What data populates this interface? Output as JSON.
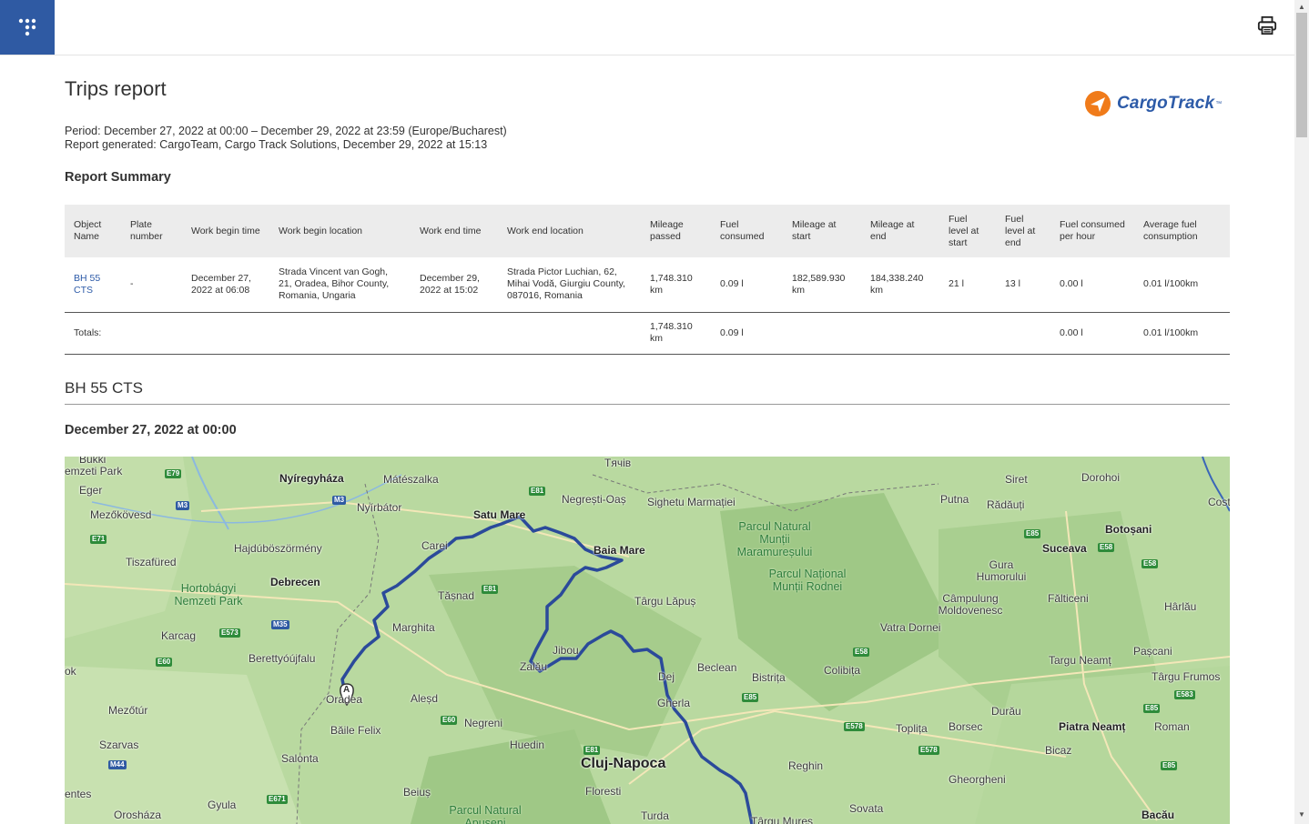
{
  "header": {
    "print_icon": "printer-icon",
    "logo_icon": "dots-logo-icon"
  },
  "report": {
    "title": "Trips report",
    "brand_name": "CargoTrack",
    "brand_tm": "™",
    "period": "Period: December 27, 2022 at 00:00 – December 29, 2022 at 23:59 (Europe/Bucharest)",
    "generated": "Report generated: CargoTeam, Cargo Track Solutions, December 29, 2022 at 15:13",
    "summary_heading": "Report Summary"
  },
  "summary_table": {
    "headers": [
      "Object Name",
      "Plate number",
      "Work begin time",
      "Work begin location",
      "Work end time",
      "Work end location",
      "Mileage passed",
      "Fuel consumed",
      "Mileage at start",
      "Mileage at end",
      "Fuel level at start",
      "Fuel level at end",
      "Fuel consumed per hour",
      "Average fuel consumption"
    ],
    "rows": [
      [
        "BH 55 CTS",
        "-",
        "December 27, 2022 at 06:08",
        "Strada Vincent van Gogh, 21, Oradea, Bihor County, Romania, Ungaria",
        "December 29, 2022 at 15:02",
        "Strada Pictor Luchian, 62, Mihai Vodă, Giurgiu County, 087016, Romania",
        "1,748.310 km",
        "0.09 l",
        "182,589.930 km",
        "184,338.240 km",
        "21 l",
        "13 l",
        "0.00 l",
        "0.01 l/100km"
      ]
    ],
    "totals": {
      "label": "Totals:",
      "mileage": "1,748.310 km",
      "fuel": "0.09 l",
      "per_hour": "0.00 l",
      "average": "0.01 l/100km"
    }
  },
  "vehicle": {
    "name": "BH 55 CTS",
    "date": "December 27, 2022 at 00:00"
  },
  "map": {
    "marker_label": "A",
    "route_color": "#2b4a9a",
    "cities": [
      "Bukki",
      "emzeti Park",
      "Eger",
      "Mezőkövesd",
      "Nyíregyháza",
      "Mátészalka",
      "Nyírbátor",
      "Tячів",
      "Negrești-Oaș",
      "Sighetu Marmației",
      "Satu Mare",
      "Carei",
      "Baia Mare",
      "Hajdúböszörmény",
      "Tiszafüred",
      "Debrecen",
      "Tășnad",
      "Târgu Lăpuș",
      "Karcag",
      "Marghita",
      "Berettyóújfalu",
      "Jibou",
      "Zalău",
      "ok",
      "Oradea",
      "Aleșd",
      "Mezőtúr",
      "Negreni",
      "Băile Felix",
      "Szarvas",
      "Salonta",
      "Huedin",
      "Cluj-Napoca",
      "Gherla",
      "Dej",
      "Beclean",
      "Bistrița",
      "Colibița",
      "Reghin",
      "Floresti",
      "Turda",
      "Beiuș",
      "Gyula",
      "Orosháza",
      "entes",
      "Siret",
      "Dorohoi",
      "Putna",
      "Rădăuți",
      "Botoșani",
      "Suceava",
      "Gura Humorului",
      "Fălticeni",
      "Hârlău",
      "Câmpulung Moldovenesc",
      "Vatra Dornei",
      "Pașcani",
      "Targu Neamț",
      "Târgu Frumos",
      "Toplița",
      "Borsec",
      "Durău",
      "Piatra Neamț",
      "Roman",
      "Bicaz",
      "Gheorgheni",
      "Sovata",
      "Bacău",
      "Târgu Mureș",
      "Cost"
    ],
    "parks": [
      "Parcul Natural Munții Maramureșului",
      "Parcul Național Munții Rodnei",
      "Hortobágyi Nemzeti Park",
      "Parcul Natural Apuseni"
    ],
    "roads": [
      "E79",
      "M3",
      "E81",
      "E71",
      "M35",
      "E573",
      "E60",
      "E81",
      "E60",
      "E81",
      "M44",
      "E671",
      "E58",
      "E85",
      "E58",
      "E58",
      "E578",
      "E578",
      "E85",
      "E583",
      "E85",
      "E85",
      "M3"
    ]
  }
}
